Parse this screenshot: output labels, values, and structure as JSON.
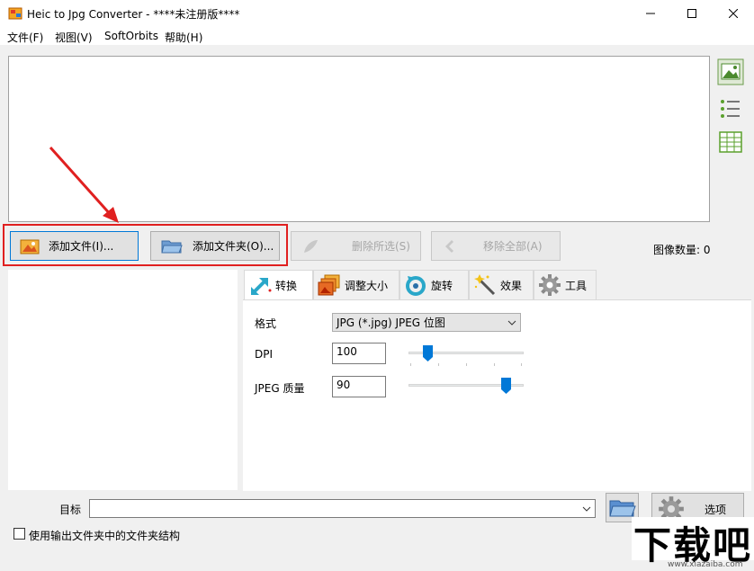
{
  "window": {
    "title": "Heic to Jpg Converter - ****未注册版****",
    "minimize_icon": "minimize-icon",
    "maximize_icon": "maximize-icon",
    "close_icon": "close-icon"
  },
  "menu": [
    "文件(F)",
    "视图(V)",
    "SoftOrbits",
    "帮助(H)"
  ],
  "toolbar": {
    "add_files": "添加文件(I)...",
    "add_folder": "添加文件夹(O)...",
    "remove_selected": "删除所选(S)",
    "remove_all": "移除全部(A)",
    "image_count_label": "图像数量: 0"
  },
  "tabs": [
    {
      "label": "转换",
      "icon": "convert-arrow-icon"
    },
    {
      "label": "调整大小",
      "icon": "resize-images-icon"
    },
    {
      "label": "旋转",
      "icon": "rotate-icon"
    },
    {
      "label": "效果",
      "icon": "magic-wand-icon"
    },
    {
      "label": "工具",
      "icon": "gear-icon"
    }
  ],
  "settings": {
    "format_label": "格式",
    "format_value": "JPG (*.jpg) JPEG 位图",
    "dpi_label": "DPI",
    "dpi_value": "100",
    "dpi_slider_fraction": 0.14,
    "quality_label": "JPEG 质量",
    "quality_value": "90",
    "quality_slider_fraction": 0.88
  },
  "bottom": {
    "target_label": "目标",
    "target_value": "",
    "options_label": "选项",
    "keep_structure_label": "使用输出文件夹中的文件夹结构",
    "keep_structure_checked": false
  },
  "watermark": {
    "text": "下载吧",
    "url": "www.xiazaiba.com"
  },
  "colors": {
    "accent_blue": "#0078d7",
    "highlight_red": "#e02020"
  }
}
